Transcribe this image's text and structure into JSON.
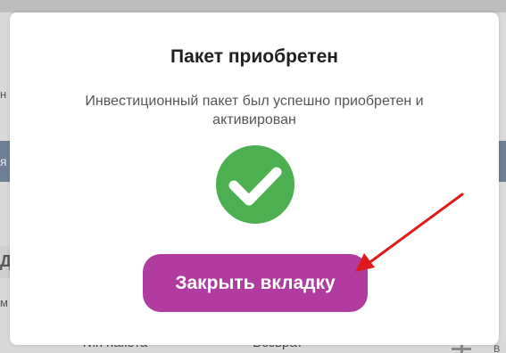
{
  "background": {
    "left_fragments": [
      "н",
      "я",
      "Д",
      "м"
    ],
    "table_headers": [
      "Тип пакета",
      "Возврат"
    ],
    "right_fragments": [
      "В"
    ]
  },
  "modal": {
    "title": "Пакет приобретен",
    "message": "Инвестиционный пакет был успешно приобретен и активирован",
    "icon": "check-circle-icon",
    "close_button_label": "Закрыть вкладку"
  },
  "colors": {
    "button_bg": "#b23b9f",
    "success_green": "#4cb050",
    "annotation_red": "#e01a1a"
  }
}
